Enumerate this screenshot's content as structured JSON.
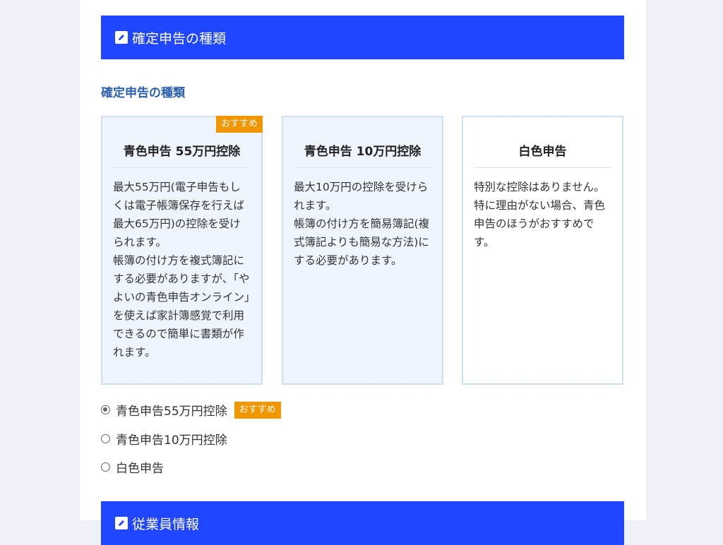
{
  "section1": {
    "title": "確定申告の種類"
  },
  "subtitle": "確定申告の種類",
  "cards": [
    {
      "title": "青色申告 55万円控除",
      "badge": "おすすめ",
      "body": "最大55万円(電子申告もしくは電子帳簿保存を行えば最大65万円)の控除を受けられます。\n帳簿の付け方を複式簿記にする必要がありますが、「やよいの青色申告オンライン」を使えば家計簿感覚で利用できるので簡単に書類が作れます。"
    },
    {
      "title": "青色申告 10万円控除",
      "body": "最大10万円の控除を受けられます。\n帳簿の付け方を簡易簿記(複式簿記よりも簡易な方法)にする必要があります。"
    },
    {
      "title": "白色申告",
      "body": "特別な控除はありません。\n特に理由がない場合、青色申告のほうがおすすめです。"
    }
  ],
  "options": [
    {
      "label": "青色申告55万円控除",
      "badge": "おすすめ",
      "checked": true
    },
    {
      "label": "青色申告10万円控除",
      "checked": false
    },
    {
      "label": "白色申告",
      "checked": false
    }
  ],
  "section2": {
    "title": "従業員情報"
  },
  "colors": {
    "header": "#2046ff",
    "badge": "#f29600",
    "subtitle": "#2a5fb0"
  },
  "icons": {
    "header_icon": "pencil-icon"
  }
}
